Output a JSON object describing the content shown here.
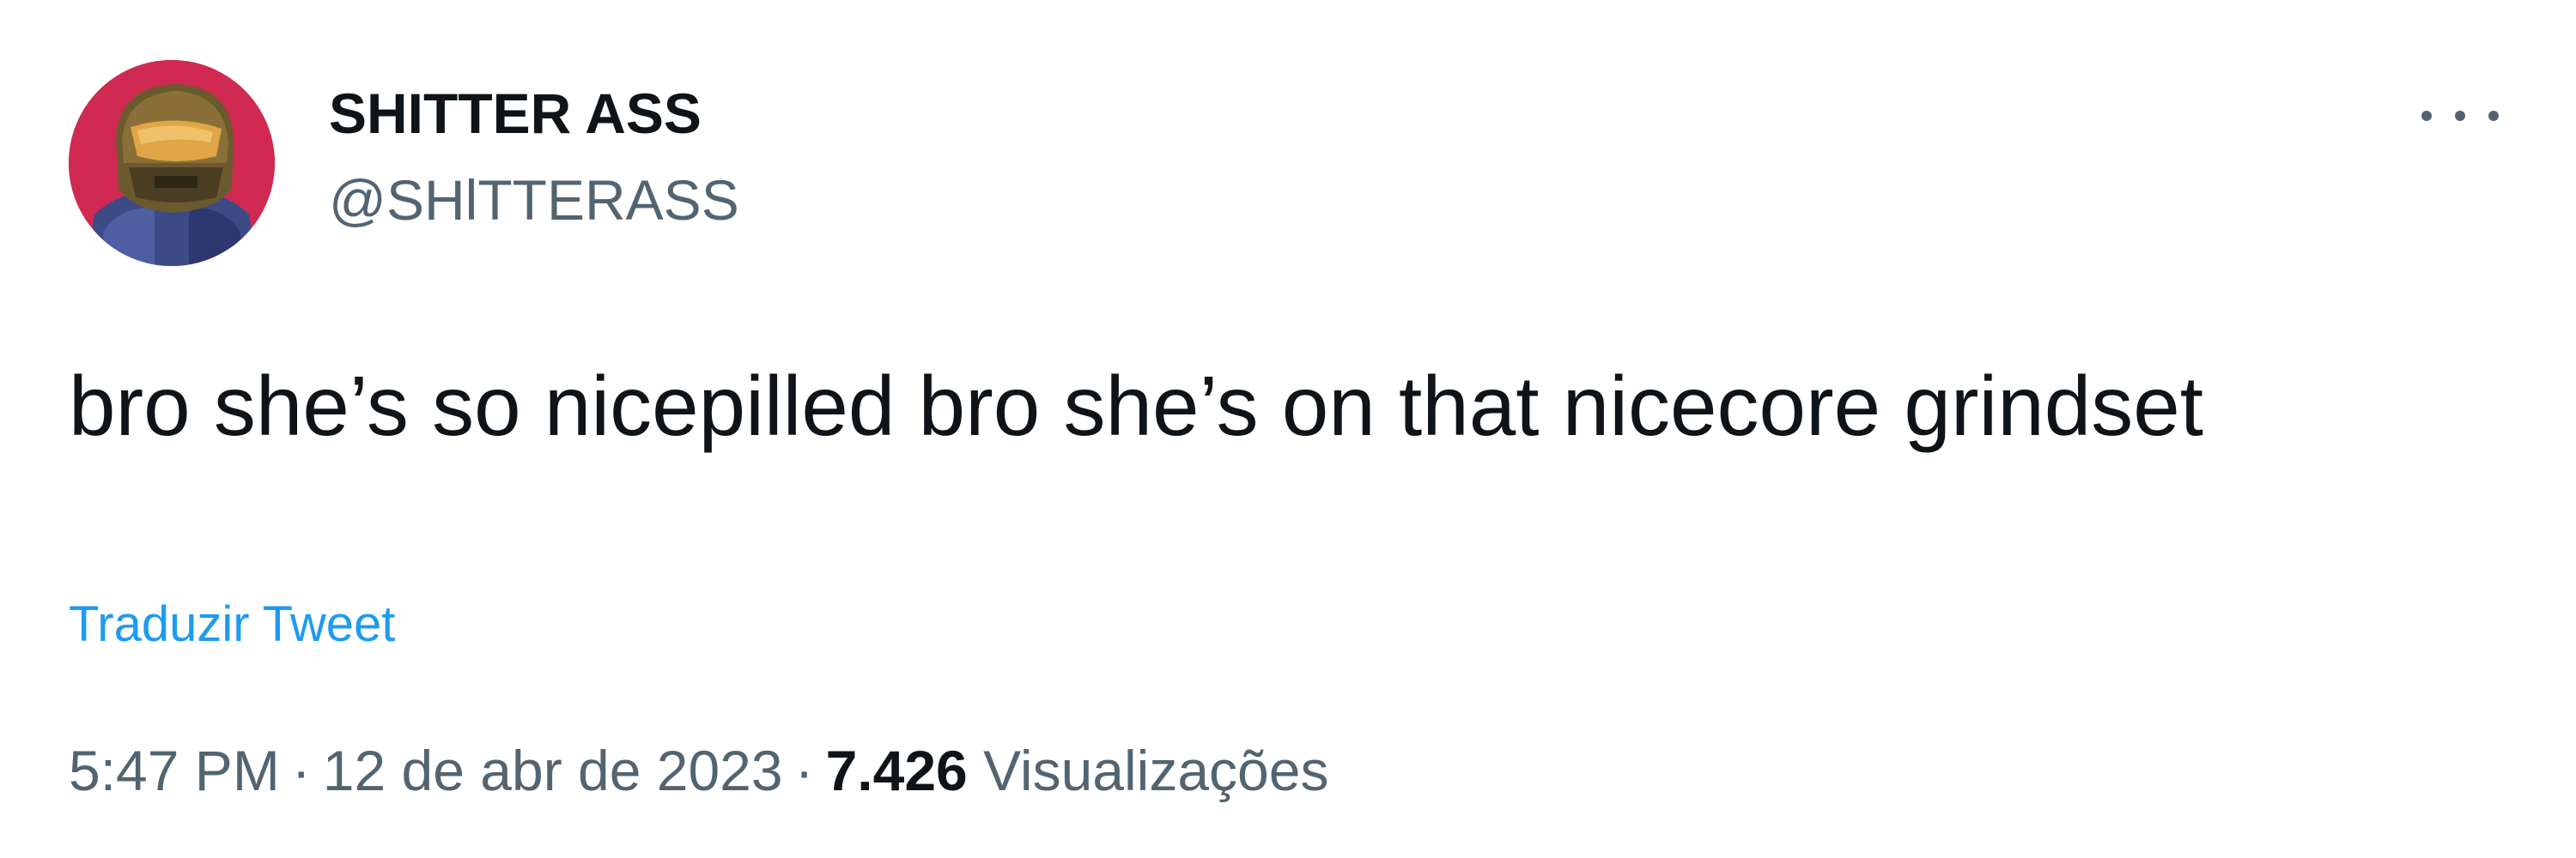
{
  "author": {
    "display_name": "SHITTER ASS",
    "handle": "@SHlTTERASS",
    "avatar": "halo-helmet-avatar"
  },
  "tweet": {
    "text": "bro she’s so nicepilled bro she’s on that nicecore grindset",
    "translate_label": "Traduzir Tweet",
    "time": "5:47 PM",
    "date": "12 de abr de 2023",
    "views_count": "7.426",
    "views_label": "Visualizações",
    "separator": "·"
  },
  "icons": {
    "more": "more-horizontal-icon"
  },
  "colors": {
    "text_primary": "#0f1419",
    "text_secondary": "#536471",
    "link": "#1d9bf0",
    "avatar_background": "#d02a52"
  }
}
